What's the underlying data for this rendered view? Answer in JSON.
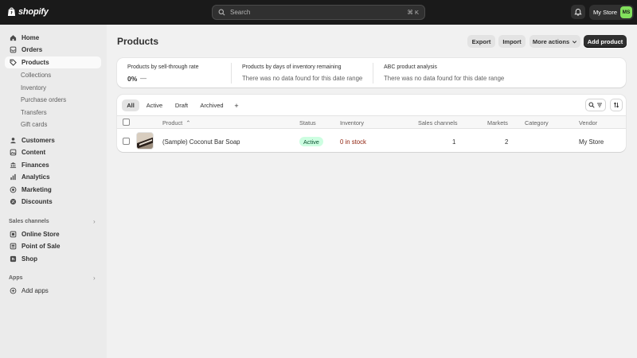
{
  "topbar": {
    "logo_text": "shopify",
    "search_placeholder": "Search",
    "search_shortcut": "⌘ K",
    "store_name": "My Store",
    "avatar_initials": "MS"
  },
  "sidebar": {
    "items": [
      {
        "label": "Home"
      },
      {
        "label": "Orders"
      },
      {
        "label": "Products"
      },
      {
        "label": "Customers"
      },
      {
        "label": "Content"
      },
      {
        "label": "Finances"
      },
      {
        "label": "Analytics"
      },
      {
        "label": "Marketing"
      },
      {
        "label": "Discounts"
      }
    ],
    "product_subitems": [
      "Collections",
      "Inventory",
      "Purchase orders",
      "Transfers",
      "Gift cards"
    ],
    "sales_channels_label": "Sales channels",
    "sales_channels": [
      {
        "label": "Online Store"
      },
      {
        "label": "Point of Sale"
      },
      {
        "label": "Shop"
      }
    ],
    "apps_label": "Apps",
    "add_apps": "Add apps"
  },
  "page": {
    "title": "Products",
    "actions": {
      "export": "Export",
      "import": "Import",
      "more_actions": "More actions",
      "add_product": "Add product"
    }
  },
  "metrics": [
    {
      "title": "Products by sell-through rate",
      "value": "0%",
      "trend": "—"
    },
    {
      "title": "Products by days of inventory remaining",
      "message": "There was no data found for this date range"
    },
    {
      "title": "ABC product analysis",
      "message": "There was no data found for this date range"
    }
  ],
  "tabs": [
    "All",
    "Active",
    "Draft",
    "Archived",
    "+"
  ],
  "table": {
    "headers": {
      "product": "Product",
      "sort_indicator": "⌃",
      "status": "Status",
      "inventory": "Inventory",
      "sales_channels": "Sales channels",
      "markets": "Markets",
      "category": "Category",
      "vendor": "Vendor"
    },
    "rows": [
      {
        "product": "(Sample) Coconut Bar Soap",
        "status": "Active",
        "inventory": "0 in stock",
        "sales_channels": "1",
        "markets": "2",
        "category": "",
        "vendor": "My Store"
      }
    ]
  },
  "colors": {
    "topbar": "#1a1a1a",
    "active_badge_bg": "#cdfee1",
    "stock_warning": "#8e1f0b",
    "avatar": "#82e05c"
  }
}
